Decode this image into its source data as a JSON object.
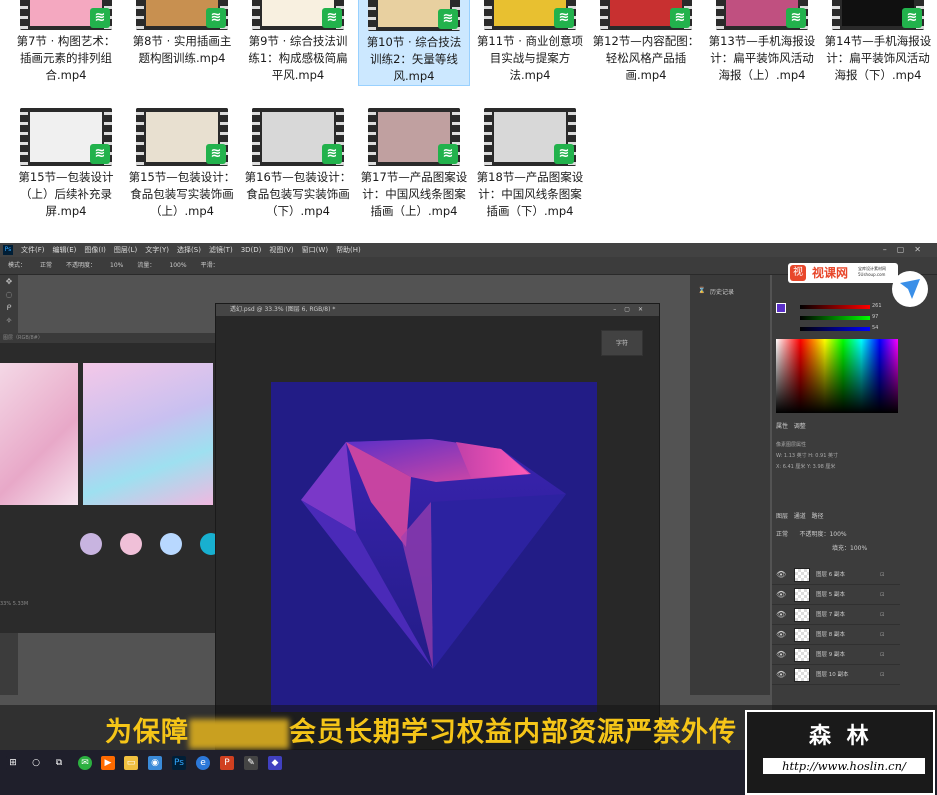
{
  "explorer": {
    "files": [
      {
        "caption": "第7节 · 构图艺术：插画元素的排列组合.mp4",
        "frame": "#f4a8c0"
      },
      {
        "caption": "第8节 · 实用插画主题构图训练.mp4",
        "frame": "#c89050"
      },
      {
        "caption": "第9节 · 综合技法训练1：构成感极简扁平风.mp4",
        "frame": "#f8f0e0"
      },
      {
        "caption": "第10节 · 综合技法训练2：矢量等线风.mp4",
        "frame": "#e8d0a0"
      },
      {
        "caption": "第11节 · 商业创意项目实战与提案方法.mp4",
        "frame": "#e8c030"
      },
      {
        "caption": "第12节—内容配图：轻松风格产品插画.mp4",
        "frame": "#c83030"
      },
      {
        "caption": "第13节—手机海报设计：扁平装饰风活动海报（上）.mp4",
        "frame": "#c05080"
      },
      {
        "caption": "第14节—手机海报设计：扁平装饰风活动海报（下）.mp4",
        "frame": "#101010"
      },
      {
        "caption": "第15节—包装设计（上）后续补充录屏.mp4",
        "frame": "#f0f0f0"
      },
      {
        "caption": "第15节—包装设计：食品包装写实装饰画（上）.mp4",
        "frame": "#e8e0d0"
      },
      {
        "caption": "第16节—包装设计：食品包装写实装饰画（下）.mp4",
        "frame": "#d8d8d8"
      },
      {
        "caption": "第17节—产品图案设计：中国风线条图案插画（上）.mp4",
        "frame": "#c0a0a0"
      },
      {
        "caption": "第18节—产品图案设计：中国风线条图案插画（下）.mp4",
        "frame": "#d8d8d8"
      }
    ],
    "badge_icon": "wechat-video-icon",
    "badge_color": "#22b24c"
  },
  "photoshop": {
    "menu": [
      "文件(F)",
      "编辑(E)",
      "图像(I)",
      "图层(L)",
      "文字(Y)",
      "选择(S)",
      "滤镜(T)",
      "3D(D)",
      "视图(V)",
      "窗口(W)",
      "帮助(H)"
    ],
    "options": [
      "模式：",
      "正常",
      "不透明度：",
      "10%",
      "流量：",
      "100%",
      "平滑："
    ],
    "doc_title": "透幻.psd @ 33.3% (图层 6, RGB/8) *",
    "bg_doc_title": "图层（RGB/8#）",
    "bg_doc_status": "33% 5.33M",
    "char_panel": "字符",
    "history_label": "历史记录",
    "properties_tab": "属性",
    "adjust_tab": "调整",
    "props_title": "像素图层属性",
    "props_lines": [
      "W: 1.13 英寸   H: 0.91 英寸",
      "X: 6.41 厘米   Y: 3.98 厘米"
    ],
    "layers_tabs": [
      "图层",
      "通道",
      "路径"
    ],
    "blend_mode": "正常",
    "opacity_label": "不透明度：100%",
    "fill_label": "填充：100%",
    "layers": [
      "图层 6 副本",
      "图层 5 副本",
      "图层 7 副本",
      "图层 8 副本",
      "图层 9 副本",
      "图层 10 副本"
    ],
    "rgb_values": [
      "261",
      "97",
      "54"
    ],
    "accent_colors": [
      "#221c86",
      "#e04aa0",
      "#5a2fc8"
    ]
  },
  "logo": {
    "mark": "视",
    "text": "视课网",
    "small": "宝库设计素材网 5Ushoup.com"
  },
  "banner": {
    "text_before": "为保障",
    "text_after": "会员长期学习权益内部资源严禁外传"
  },
  "hoslin": {
    "name": "森 林",
    "url": "http://www.hoslin.cn/"
  }
}
